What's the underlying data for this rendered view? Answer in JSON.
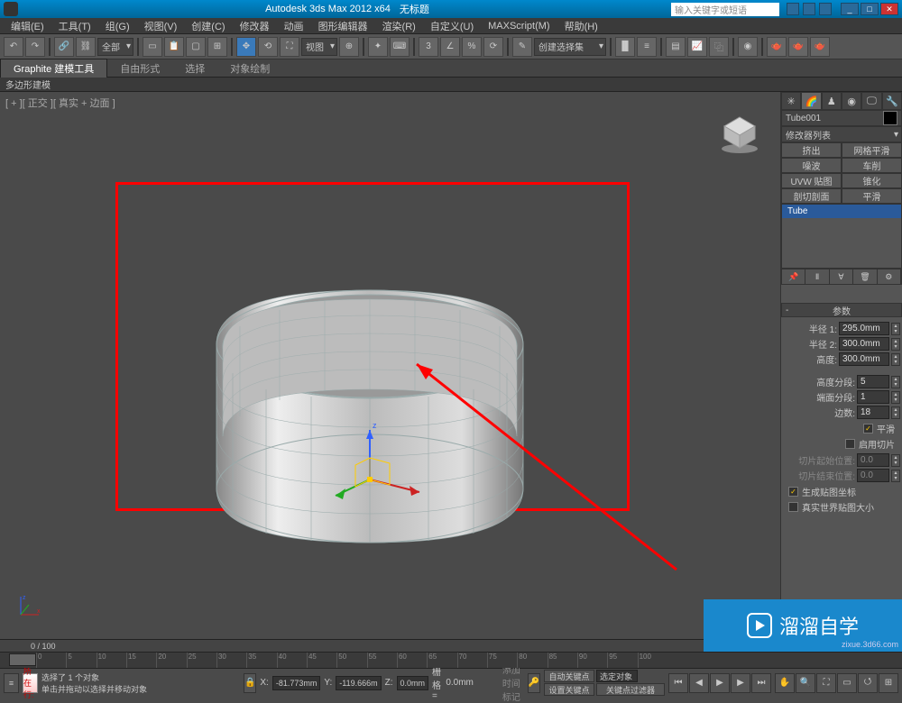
{
  "title": {
    "app": "Autodesk 3ds Max  2012  x64",
    "doc": "无标题"
  },
  "search_placeholder": "输入关键字或短语",
  "menu": [
    "编辑(E)",
    "工具(T)",
    "组(G)",
    "视图(V)",
    "创建(C)",
    "修改器",
    "动画",
    "图形编辑器",
    "渲染(R)",
    "自定义(U)",
    "MAXScript(M)",
    "帮助(H)"
  ],
  "toolbar": {
    "set_dropdown": "全部",
    "view_dropdown": "视图",
    "select_dropdown": "创建选择集"
  },
  "ribbon": {
    "tabs": [
      "Graphite 建模工具",
      "自由形式",
      "选择",
      "对象绘制"
    ],
    "sub": "多边形建模"
  },
  "viewport": {
    "label": "[ + ][ 正交 ][ 真实 + 边面 ]"
  },
  "trackbar": {
    "range": "0 / 100"
  },
  "panel": {
    "object_name": "Tube001",
    "modlist": "修改器列表",
    "button_set": [
      "挤出",
      "网格平滑",
      "噪波",
      "车削",
      "UVW 贴图",
      "锥化",
      "剖切剖面",
      "平滑"
    ],
    "stack_item": "Tube",
    "rollout": "参数",
    "params": {
      "radius1_lbl": "半径 1:",
      "radius1_val": "295.0mm",
      "radius2_lbl": "半径 2:",
      "radius2_val": "300.0mm",
      "height_lbl": "高度:",
      "height_val": "300.0mm",
      "hseg_lbl": "高度分段:",
      "hseg_val": "5",
      "cseg_lbl": "端面分段:",
      "cseg_val": "1",
      "sides_lbl": "边数:",
      "sides_val": "18"
    },
    "smooth": "平滑",
    "slice_on": "启用切片",
    "slice_from_lbl": "切片起始位置:",
    "slice_from_val": "0.0",
    "slice_to_lbl": "切片结束位置:",
    "slice_to_val": "0.0",
    "gen_map": "生成贴图坐标",
    "real_world": "真实世界贴图大小"
  },
  "status": {
    "location_btn": "所在行:",
    "prompt1": "选择了 1 个对象",
    "prompt2": "单击并拖动以选择并移动对象",
    "lock": "🔒",
    "x_lbl": "X:",
    "x_val": "-81.773mm",
    "y_lbl": "Y:",
    "y_val": "-119.666m",
    "z_lbl": "Z:",
    "z_val": "0.0mm",
    "grid_lbl": "栅格 =",
    "grid_val": "0.0mm",
    "autokey": "自动关键点",
    "selset": "选定对象",
    "setkey": "设置关键点",
    "keyflt": "关键点过滤器",
    "addtime": "添加时间标记"
  },
  "watermark": {
    "text": "溜溜自学",
    "url": "zixue.3d66.com"
  }
}
